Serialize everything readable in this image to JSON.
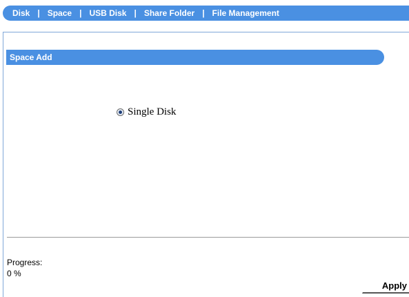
{
  "nav": {
    "items": [
      {
        "label": "Disk"
      },
      {
        "label": "Space"
      },
      {
        "label": "USB Disk"
      },
      {
        "label": "Share Folder"
      },
      {
        "label": "File Management"
      }
    ],
    "separator": "|"
  },
  "section": {
    "title": "Space Add"
  },
  "option": {
    "label": "Single Disk",
    "selected": true
  },
  "progress": {
    "label": "Progress:",
    "value_text": "0 %"
  },
  "actions": {
    "apply_label": "Apply"
  },
  "colors": {
    "accent": "#4a90e2",
    "panel_border": "#7fa7d8"
  }
}
